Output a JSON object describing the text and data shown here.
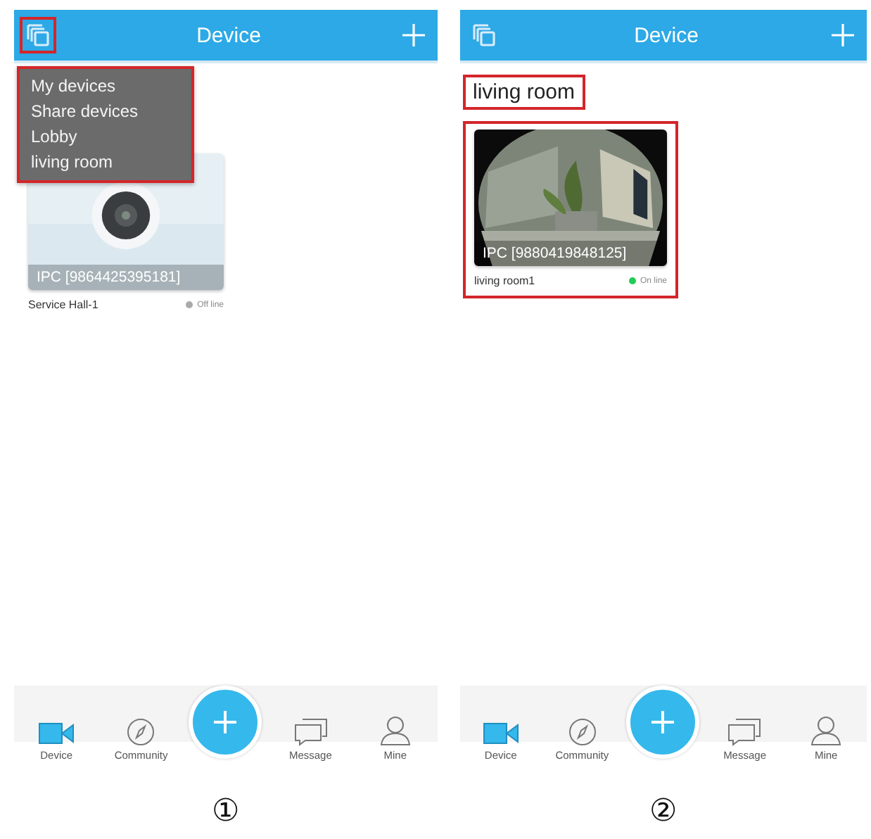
{
  "panels": [
    {
      "caption": "①",
      "header": {
        "title": "Device",
        "icon_highlighted": true
      },
      "dropdown": {
        "highlighted": true,
        "items": [
          "My devices",
          "Share devices",
          "Lobby",
          "living room"
        ]
      },
      "devices": [
        {
          "camera_label": "IPC [9864425395181]",
          "name": "Service Hall-1",
          "status": "Off line",
          "online": false,
          "highlighted": false
        }
      ],
      "nav": [
        {
          "label": "Device",
          "kind": "device",
          "selected": true
        },
        {
          "label": "Community",
          "kind": "community",
          "selected": false
        },
        {
          "label": "Message",
          "kind": "message",
          "selected": false
        },
        {
          "label": "Mine",
          "kind": "mine",
          "selected": false
        }
      ]
    },
    {
      "caption": "②",
      "header": {
        "title": "Device",
        "icon_highlighted": false
      },
      "group_title": {
        "text": "living room",
        "highlighted": true
      },
      "devices": [
        {
          "camera_label": "IPC [9880419848125]",
          "name": "living room1",
          "status": "On line",
          "online": true,
          "highlighted": true
        }
      ],
      "nav": [
        {
          "label": "Device",
          "kind": "device",
          "selected": true
        },
        {
          "label": "Community",
          "kind": "community",
          "selected": false
        },
        {
          "label": "Message",
          "kind": "message",
          "selected": false
        },
        {
          "label": "Mine",
          "kind": "mine",
          "selected": false
        }
      ]
    }
  ]
}
